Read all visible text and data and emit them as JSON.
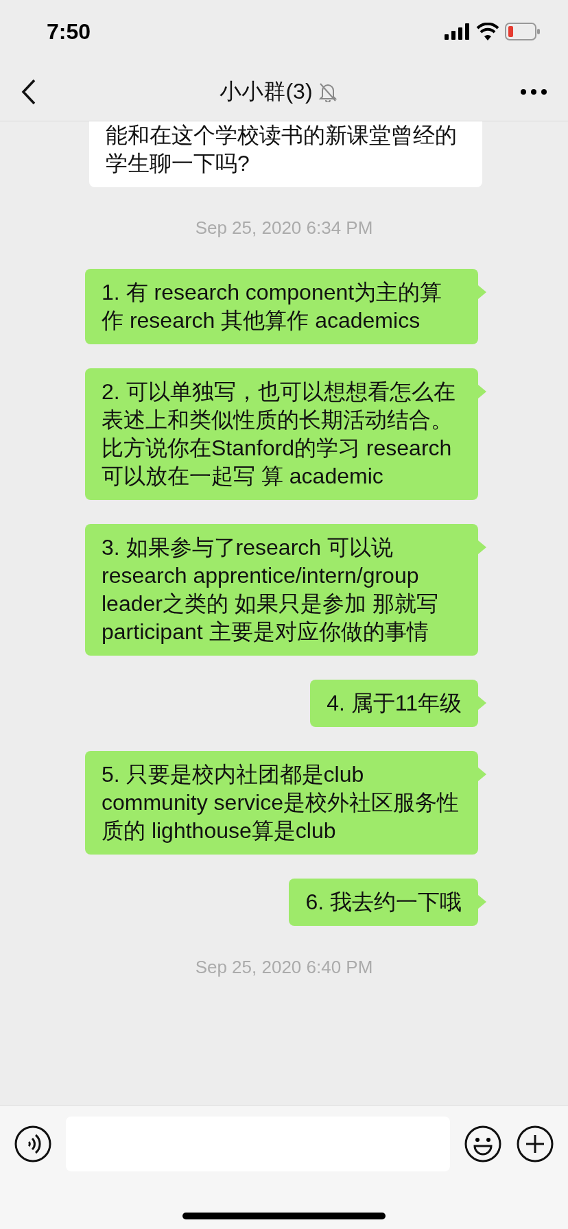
{
  "status_bar": {
    "time": "7:50"
  },
  "header": {
    "title": "小小群(3)",
    "muted": true
  },
  "messages": [
    {
      "kind": "received",
      "text": "能和在这个学校读书的新课堂曾经的学生聊一下吗?"
    },
    {
      "kind": "timestamp",
      "text": "Sep 25, 2020 6:34 PM"
    },
    {
      "kind": "sent",
      "text": "1. 有 research component为主的算作 research 其他算作 academics"
    },
    {
      "kind": "sent",
      "text": "2. 可以单独写，也可以想想看怎么在表述上和类似性质的长期活动结合。比方说你在Stanford的学习 research可以放在一起写 算 academic"
    },
    {
      "kind": "sent",
      "text": "3. 如果参与了research 可以说 research apprentice/intern/group leader之类的 如果只是参加 那就写participant 主要是对应你做的事情"
    },
    {
      "kind": "sent",
      "text": "4. 属于11年级"
    },
    {
      "kind": "sent",
      "text": "5. 只要是校内社团都是club community service是校外社区服务性质的 lighthouse算是club"
    },
    {
      "kind": "sent",
      "text": "6. 我去约一下哦"
    },
    {
      "kind": "timestamp",
      "text": "Sep 25, 2020 6:40 PM"
    }
  ]
}
